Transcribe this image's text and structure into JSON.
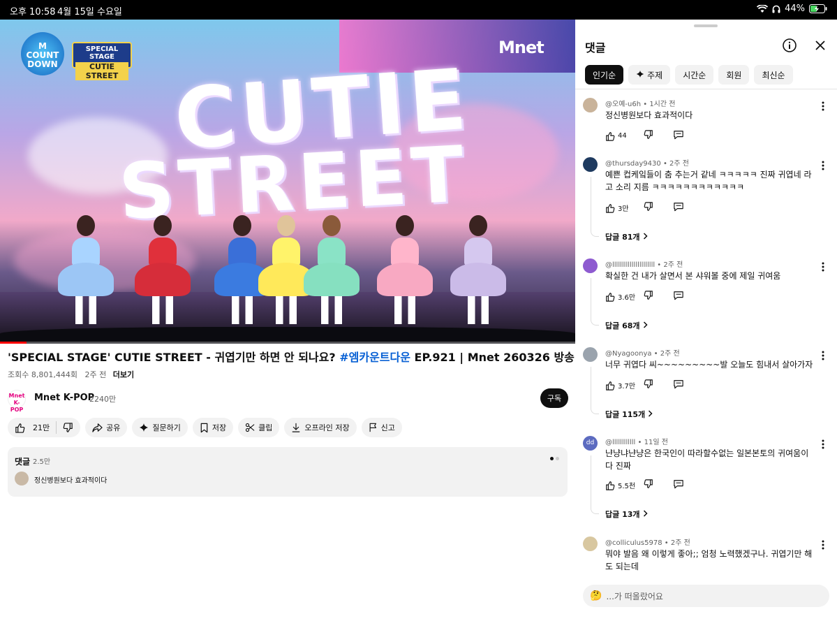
{
  "status": {
    "time": "오후 10:58",
    "date": "4월 15일 수요일",
    "battery": "44%"
  },
  "video": {
    "overlay_count_logo": "M COUNT DOWN",
    "overlay_stage_line1": "SPECIAL STAGE",
    "overlay_stage_line2": "CUTIE STREET",
    "overlay_brand": "Mnet",
    "stage_text_1": "CUTIE",
    "stage_text_2": "STREET",
    "progress": 0.046
  },
  "title": {
    "part1": "'SPECIAL STAGE' CUTIE STREET - 귀엽기만 하면 안 되나요? ",
    "hashtag": "#엠카운트다운",
    "part2": " EP.921 | Mnet 260326 방송"
  },
  "meta": {
    "views": "조회수 8,801,444회",
    "age": "2주 전",
    "more": "더보기"
  },
  "channel": {
    "logo_text": "Mnet K-POP",
    "name": "Mnet K-POP",
    "subs": "2240만",
    "subscribe": "구독"
  },
  "actions": {
    "like_count": "21만",
    "share": "공유",
    "ask": "질문하기",
    "save": "저장",
    "clip": "클립",
    "offline": "오프라인 저장",
    "report": "신고"
  },
  "comment_preview": {
    "label": "댓글",
    "count": "2.5만",
    "text": "정신병원보다 효과적이다"
  },
  "panel": {
    "title": "댓글",
    "filters": [
      "인기순",
      "주제",
      "시간순",
      "회원",
      "최신순"
    ],
    "input_placeholder": "...가 떠올랐어요",
    "input_emoji": "🤔"
  },
  "comments": [
    {
      "author": "@오예-u6h",
      "age": "1시간 전",
      "text": "정신병원보다 효과적이다",
      "likes": "44",
      "replies": "",
      "avatar_color": "#c9b39a",
      "avatar_text": ""
    },
    {
      "author": "@thursday9430",
      "age": "2주 전",
      "text": "예쁜 컵케잌들이 춤 추는거 같네 ㅋㅋㅋㅋㅋ 진짜 귀엽네 라고 소리 지름 ㅋㅋㅋㅋㅋㅋㅋㅋㅋㅋㅋㅋ",
      "likes": "3만",
      "replies": "답글 81개",
      "avatar_color": "#1e3a5f",
      "avatar_text": ""
    },
    {
      "author": "@llllllllllllllllllllll",
      "age": "2주 전",
      "text": "확실한 건 내가 살면서 본 샤워볼 중에 제일 귀여움",
      "likes": "3.6만",
      "replies": "답글 68개",
      "avatar_color": "#8e5bd0",
      "avatar_text": ""
    },
    {
      "author": "@Nyagoonya",
      "age": "2주 전",
      "text": "너무 귀엽다 씨~~~~~~~~~발 오늘도 힘내서 살아가자",
      "likes": "3.7만",
      "replies": "답글 115개",
      "avatar_color": "#9aa3ad",
      "avatar_text": ""
    },
    {
      "author": "@llllllllllll",
      "age": "11일 전",
      "text": "냔냥냐냔냥은 한국인이 따라할수없는 일본본토의 귀여움이다 진짜",
      "likes": "5.5천",
      "replies": "답글 13개",
      "avatar_color": "#5c6bc0",
      "avatar_text": "dd"
    },
    {
      "author": "@colliculus5978",
      "age": "2주 전",
      "text": "뭐야 발음 왜 이렇게 좋아;; 엄청 노력했겠구나. 귀엽기만 해도 되는데",
      "likes": "",
      "replies": "",
      "avatar_color": "#d8c7a0",
      "avatar_text": ""
    }
  ]
}
